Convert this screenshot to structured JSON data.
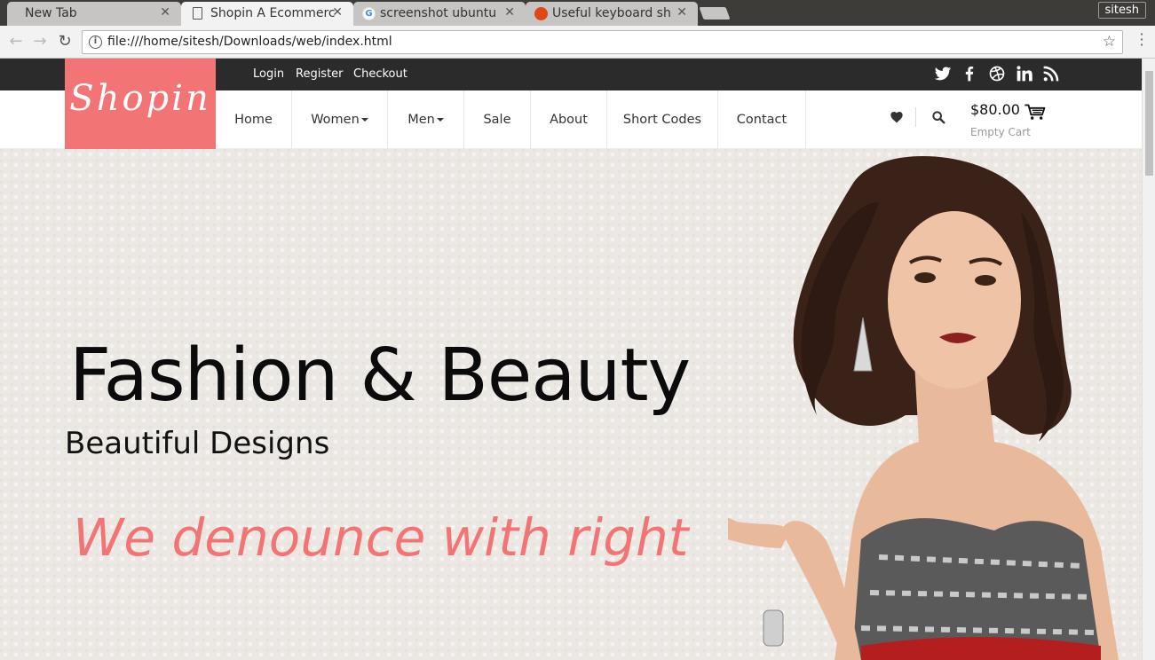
{
  "browser": {
    "tabs": [
      {
        "title": "New Tab",
        "active": false
      },
      {
        "title": "Shopin A Ecommerce",
        "active": true
      },
      {
        "title": "screenshot ubuntu",
        "active": false
      },
      {
        "title": "Useful keyboard sh",
        "active": false
      }
    ],
    "profile_name": "sitesh",
    "url": "file:///home/sitesh/Downloads/web/index.html"
  },
  "site": {
    "brand": "Shopin",
    "brand_color": "#f27474",
    "top_links": [
      "Login",
      "Register",
      "Checkout"
    ],
    "social_icons": [
      "twitter-icon",
      "facebook-icon",
      "dribbble-icon",
      "linkedin-icon",
      "rss-icon"
    ],
    "nav": [
      {
        "label": "Home",
        "dropdown": false
      },
      {
        "label": "Women",
        "dropdown": true
      },
      {
        "label": "Men",
        "dropdown": true
      },
      {
        "label": "Sale",
        "dropdown": false
      },
      {
        "label": "About",
        "dropdown": false
      },
      {
        "label": "Short Codes",
        "dropdown": false
      },
      {
        "label": "Contact",
        "dropdown": false
      }
    ],
    "cart": {
      "amount": "$80.00",
      "status": "Empty Cart"
    }
  },
  "hero": {
    "title": "Fashion & Beauty",
    "subtitle": "Beautiful Designs",
    "tagline": "We denounce with right"
  }
}
